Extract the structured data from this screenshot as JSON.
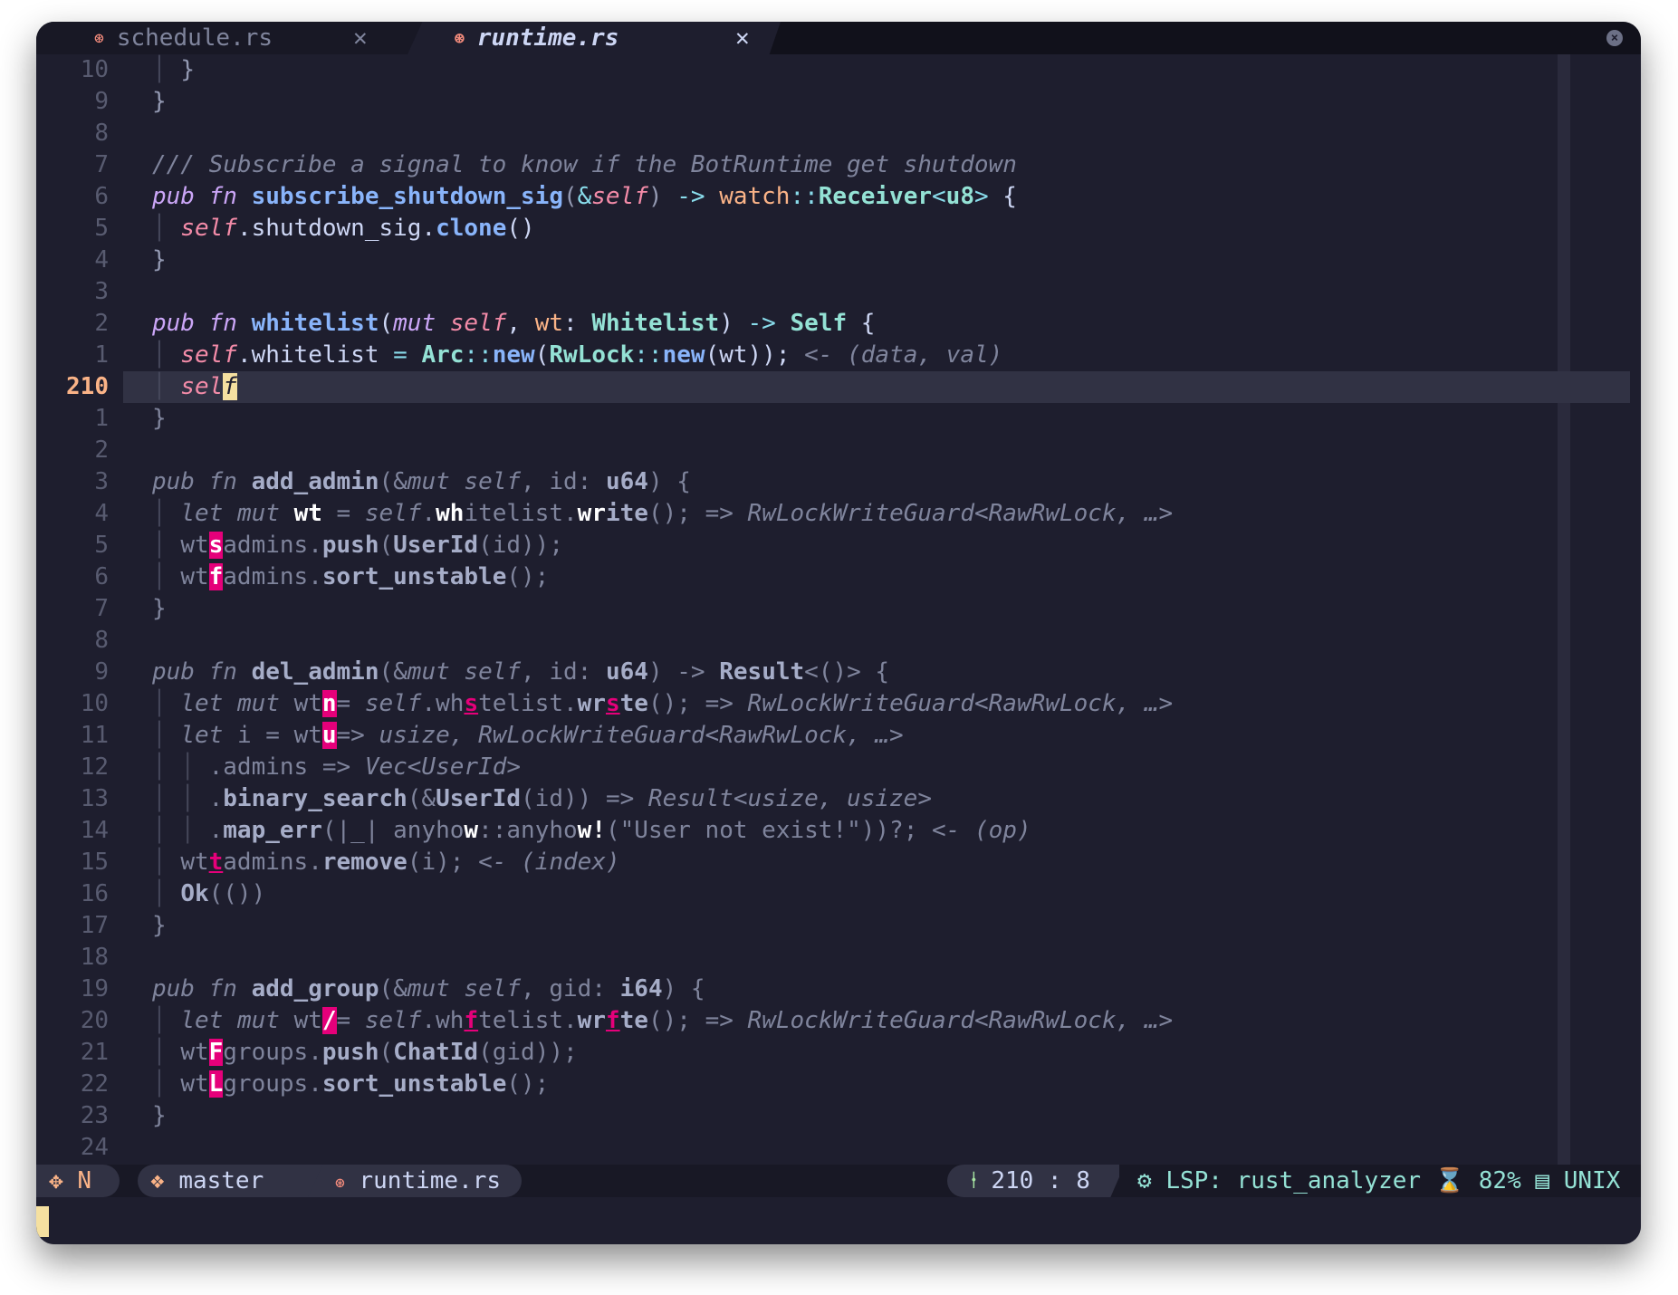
{
  "tabs": [
    {
      "label": "schedule.rs",
      "close": "✕",
      "active": false
    },
    {
      "label": "runtime.rs",
      "close": "✕",
      "active": true
    }
  ],
  "window_close": "×",
  "line_numbers": [
    "10",
    "9",
    "8",
    "7",
    "6",
    "5",
    "4",
    "3",
    "2",
    "1",
    "210",
    "1",
    "2",
    "3",
    "4",
    "5",
    "6",
    "7",
    "8",
    "9",
    "10",
    "11",
    "12",
    "13",
    "14",
    "15",
    "16",
    "17",
    "18",
    "19",
    "20",
    "21",
    "22",
    "23",
    "24"
  ],
  "code": {
    "comment_subscribe": "/// Subscribe a signal to know if the BotRuntime get shutdown",
    "kw_pub": "pub",
    "kw_fn": "fn",
    "kw_mut": "mut",
    "kw_let": "let",
    "fn_subscribe": "subscribe_shutdown_sig",
    "self": "self",
    "watch": "watch",
    "receiver": "Receiver",
    "u8": "u8",
    "shutdown_sig": "shutdown_sig",
    "clone": "clone",
    "fn_whitelist": "whitelist",
    "wt": "wt",
    "Whitelist": "Whitelist",
    "Self": "Self",
    "Arc": "Arc",
    "new": "new",
    "RwLock": "RwLock",
    "hint_data_val": "<- (data, val)",
    "cur_self_prefix": "sel",
    "cur_self_char": "f",
    "add_admin": "add_admin",
    "id": "id",
    "u64": "u64",
    "write": "write",
    "hint_guard": "=> RwLockWriteGuard<RawRwLock, …>",
    "admins": "admins",
    "push": "push",
    "UserId": "UserId",
    "sort_unstable": "sort_unstable",
    "del_admin": "del_admin",
    "Result": "Result",
    "hint_usize_guard": "=> usize, RwLockWriteGuard<RawRwLock, …>",
    "hint_vec": "=> Vec<UserId>",
    "binary_search": "binary_search",
    "hint_result": "=> Result<usize, usize>",
    "map_err": "map_err",
    "anyhow_a": "anyho",
    "user_not_exist": "\"User not exist!\"",
    "hint_op": "<- (op)",
    "remove": "remove",
    "hint_index": "<- (index)",
    "Ok": "Ok",
    "add_group": "add_group",
    "gid": "gid",
    "i64": "i64",
    "groups": "groups",
    "ChatId": "ChatId",
    "jump_labels": [
      "s",
      "f",
      "n",
      "s",
      "s",
      "u",
      "w",
      "w",
      "t",
      "f",
      "f",
      "F",
      "L"
    ],
    "white_wh": "wh",
    "white_wr": "wr",
    "white_ite": "ite",
    "i_var": "i"
  },
  "statusbar": {
    "mode_icon": "✥",
    "mode": "N",
    "git_icon": "❖",
    "branch": "master",
    "file_icon": "⊛",
    "file": "runtime.rs",
    "pos_icon": "⍿",
    "position": "210 : 8",
    "lsp_icon": "⚙",
    "lsp": "LSP: rust_analyzer",
    "progress_icon": "⌛",
    "progress": "82%",
    "format_icon": "▤",
    "format": "UNIX"
  },
  "colors": {
    "background": "#1e1e2e",
    "jump_label": "#e5007a",
    "cursor": "#f5e0a0",
    "current_line_number": "#fab387"
  }
}
